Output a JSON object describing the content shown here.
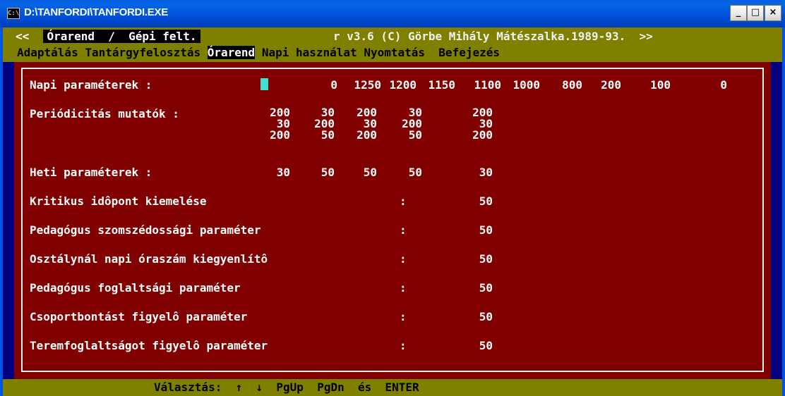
{
  "window": {
    "title": "D:\\TANFORDI\\TANFORDI.EXE",
    "icon_text": "C:\\",
    "minimize": "_",
    "maximize": "□",
    "close": "×"
  },
  "header": {
    "left_arrow": "<<",
    "title": "Órarend  /  Gépi felt.",
    "rest": "r v3.6 (C) Görbe Mihály Mátészalka.1989-93.",
    "right_arrow": ">>"
  },
  "menu": {
    "items": [
      {
        "label": "Adaptálás",
        "active": false
      },
      {
        "label": "Tantárgyfelosztás",
        "active": false
      },
      {
        "label": "Órarend",
        "active": true
      },
      {
        "label": "Napi használat",
        "active": false
      },
      {
        "label": "Nyomtatás",
        "active": false
      },
      {
        "label": "Befejezés",
        "active": false
      }
    ]
  },
  "params": {
    "napi": {
      "label": "Napi paraméterek :",
      "values": [
        "0",
        "1250",
        "1200",
        "1150",
        "1100",
        "1000",
        "800",
        "200",
        "100",
        "0"
      ]
    },
    "periodicitas": {
      "label": "Periódicitás mutatók :",
      "rows": [
        [
          "200",
          "30",
          "200",
          "30",
          "200"
        ],
        [
          "30",
          "200",
          "30",
          "200",
          "30"
        ],
        [
          "200",
          "50",
          "200",
          "50",
          "200"
        ]
      ]
    },
    "heti": {
      "label": "Heti paraméterek :",
      "values": [
        "30",
        "50",
        "50",
        "50",
        "30"
      ]
    },
    "single": [
      {
        "label": "Kritikus idôpont kiemelése",
        "value": "50"
      },
      {
        "label": "Pedagógus szomszédossági paraméter",
        "value": "50"
      },
      {
        "label": "Osztálynál napi óraszám kiegyenlítô",
        "value": "50"
      },
      {
        "label": "Pedagógus foglaltsági paraméter",
        "value": "50"
      },
      {
        "label": "Csoportbontást figyelô paraméter",
        "value": "50"
      },
      {
        "label": "Teremfoglaltságot figyelô paraméter",
        "value": "50"
      }
    ],
    "colon": ":"
  },
  "status": {
    "text": "Választás:  ↑  ↓  PgUp  PgDn  és  ENTER"
  },
  "colors": {
    "panel": "#800000",
    "menu_bar": "#808000",
    "sides": "#000080",
    "cursor": "#3fe0d0"
  }
}
